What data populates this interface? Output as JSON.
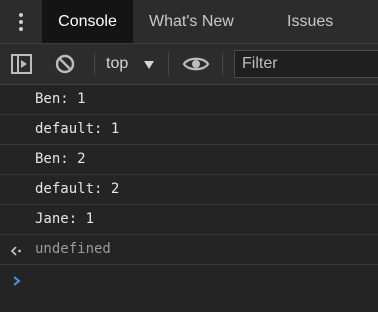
{
  "tabs": [
    {
      "label": "Console",
      "active": true
    },
    {
      "label": "What's New",
      "active": false
    },
    {
      "label": "Issues",
      "active": false
    }
  ],
  "toolbar": {
    "context_label": "top",
    "filter_placeholder": "Filter",
    "icons": [
      "sidebar-toggle-icon",
      "clear-console-icon",
      "chevron-down-icon",
      "eye-icon"
    ]
  },
  "console": {
    "messages": [
      "Ben: 1",
      "default: 1",
      "Ben: 2",
      "default: 2",
      "Jane: 1"
    ],
    "result": "undefined"
  },
  "colors": {
    "background": "#242424",
    "toolbar": "#2c2c2c",
    "active_tab": "#141414",
    "result_text": "#9a9a9a",
    "prompt_accent": "#4e8ff5"
  }
}
